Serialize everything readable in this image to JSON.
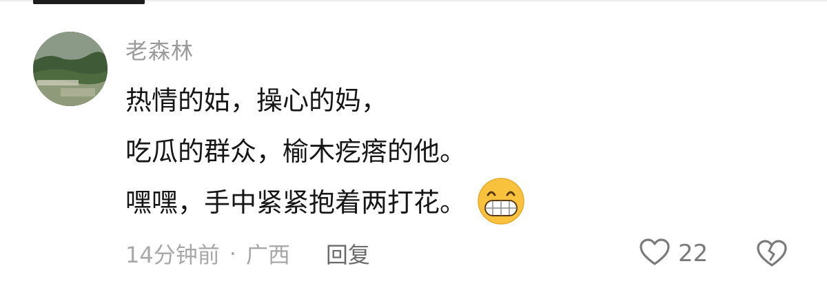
{
  "comment": {
    "username": "老森林",
    "lines": [
      "热情的姑，操心的妈，",
      "吃瓜的群众，榆木疙瘩的他。",
      "嘿嘿，手中紧紧抱着两打花。"
    ],
    "trailing_emoji": "grinning-face-emoji"
  },
  "meta": {
    "time": "14分钟前",
    "separator": "·",
    "location": "广西",
    "reply_label": "回复"
  },
  "actions": {
    "like_count": "22",
    "like_icon": "heart-outline-icon",
    "dislike_icon": "broken-heart-icon"
  },
  "colors": {
    "username": "#9a9a9a",
    "text": "#161616",
    "meta": "#a8a8a8",
    "reply": "#6a6a6a",
    "icon": "#7a7a7a"
  }
}
